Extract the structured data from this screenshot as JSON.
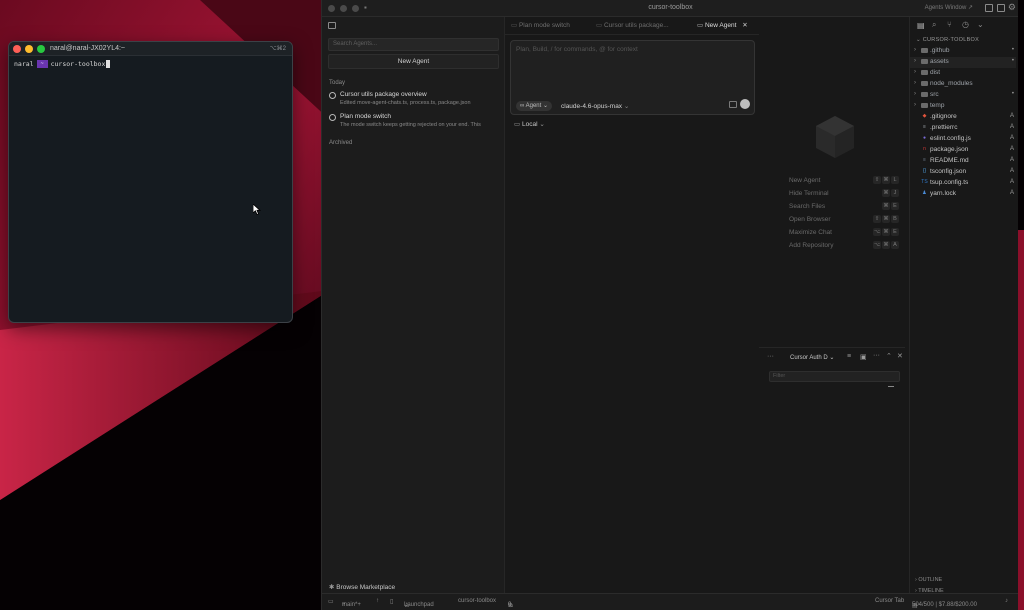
{
  "desktop": {
    "bg_dark": "#0a0306",
    "bg_red": "#8a0f2a"
  },
  "terminal": {
    "title": "naral@naral-JX02YL4:~",
    "shortcut": "⌥⌘2",
    "prompt_user": "naral",
    "prompt_seg": "~",
    "command": "cursor-toolbox"
  },
  "app": {
    "title": "cursor-toolbox",
    "agents_window_label": "Agents Window ↗",
    "left": {
      "search_placeholder": "Search Agents...",
      "new_agent": "New Agent",
      "section_today": "Today",
      "chats": [
        {
          "title": "Cursor utils package overview",
          "subtitle": "Edited move-agent-chats.ts, process.ts, package.json"
        },
        {
          "title": "Plan mode switch",
          "subtitle": "The mode switch keeps getting rejected on your end. This"
        }
      ],
      "section_archived": "Archived",
      "browse_marketplace": "Browse Marketplace"
    },
    "tabs": [
      {
        "label": "Plan mode switch"
      },
      {
        "label": "Cursor utils package..."
      },
      {
        "label": "New Agent",
        "close": "✕"
      }
    ],
    "composer": {
      "placeholder": "Plan, Build, / for commands, @ for context",
      "mode": "Agent",
      "model": "claude-4.6-opus-max",
      "env": "Local"
    },
    "shortcuts": [
      {
        "label": "New Agent",
        "keys": [
          "⇧",
          "⌘",
          "L"
        ]
      },
      {
        "label": "Hide Terminal",
        "keys": [
          "⌘",
          "J"
        ]
      },
      {
        "label": "Search Files",
        "keys": [
          "⌘",
          "E"
        ]
      },
      {
        "label": "Open Browser",
        "keys": [
          "⇧",
          "⌘",
          "B"
        ]
      },
      {
        "label": "Maximize Chat",
        "keys": [
          "⌥",
          "⌘",
          "E"
        ]
      },
      {
        "label": "Add Repository",
        "keys": [
          "⌥",
          "⌘",
          "A"
        ]
      }
    ],
    "explorer": {
      "root": "CURSOR-TOOLBOX",
      "items": [
        {
          "name": ".github",
          "folder": true,
          "status": "•"
        },
        {
          "name": "assets",
          "folder": true,
          "status": "•",
          "selected": true
        },
        {
          "name": "dist",
          "folder": true,
          "status": ""
        },
        {
          "name": "node_modules",
          "folder": true,
          "status": ""
        },
        {
          "name": "src",
          "folder": true,
          "status": "•"
        },
        {
          "name": "temp",
          "folder": true,
          "status": ""
        },
        {
          "name": ".gitignore",
          "folder": false,
          "status": "A",
          "icon": "◆",
          "color": "#e0533c"
        },
        {
          "name": ".prettierrc",
          "folder": false,
          "status": "A",
          "icon": "≡",
          "color": "#9aa0a6"
        },
        {
          "name": "eslint.config.js",
          "folder": false,
          "status": "A",
          "icon": "●",
          "color": "#7b6cd9"
        },
        {
          "name": "package.json",
          "folder": false,
          "status": "A",
          "icon": "n",
          "color": "#cb3837"
        },
        {
          "name": "README.md",
          "folder": false,
          "status": "A",
          "icon": "≡",
          "color": "#6b7a8a"
        },
        {
          "name": "tsconfig.json",
          "folder": false,
          "status": "A",
          "icon": "{}",
          "color": "#4f9ddb"
        },
        {
          "name": "tsup.config.ts",
          "folder": false,
          "status": "A",
          "icon": "TS",
          "color": "#3178c6"
        },
        {
          "name": "yarn.lock",
          "folder": false,
          "status": "A",
          "icon": "♟",
          "color": "#4a8bd6"
        }
      ],
      "outline": "OUTLINE",
      "timeline": "TIMELINE"
    },
    "terminal_panel": {
      "tab": "Cursor Auth D",
      "filter_placeholder": "Filter"
    },
    "status": {
      "branch": "main*+",
      "launchpad": "Launchpad",
      "project": "cursor-toolbox",
      "errors": "0",
      "warnings": "0",
      "cursor_tab": "Cursor Tab",
      "usage": "504/500 | $7.88/$200.00"
    }
  }
}
